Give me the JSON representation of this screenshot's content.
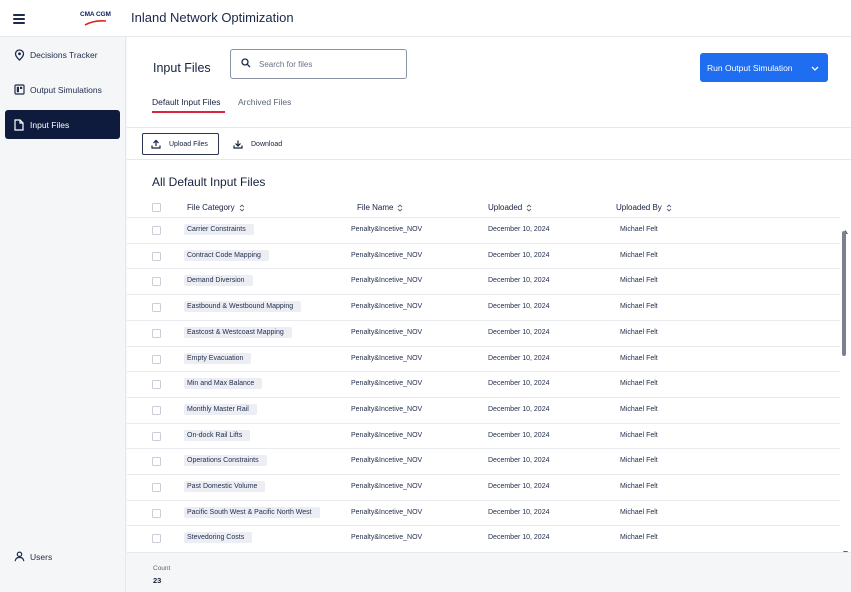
{
  "app": {
    "logo_text": "CMA CGM",
    "title": "Inland Network Optimization"
  },
  "sidebar": {
    "items": [
      {
        "label": "Decisions Tracker",
        "icon": "location-pin-icon"
      },
      {
        "label": "Output Simulations",
        "icon": "dashboard-icon"
      },
      {
        "label": "Input Files",
        "icon": "file-icon",
        "active": true
      }
    ],
    "users_label": "Users"
  },
  "main": {
    "page_title": "Input Files",
    "search_placeholder": "Search for files",
    "run_button_label": "Run Output Simulation",
    "tabs": [
      {
        "label": "Default Input Files",
        "active": true
      },
      {
        "label": "Archived Files",
        "active": false
      }
    ],
    "upload_label": "Upload Files",
    "download_label": "Download",
    "section_title": "All Default Input Files",
    "columns": [
      "File Category",
      "File Name",
      "Uploaded",
      "Uploaded By"
    ],
    "rows": [
      {
        "category": "Carrier Constraints",
        "file": "Penalty&Incetive_NOV",
        "uploaded": "December 10, 2024",
        "by": "Michael Felt"
      },
      {
        "category": "Contract Code Mapping",
        "file": "Penalty&Incetive_NOV",
        "uploaded": "December 10, 2024",
        "by": "Michael Felt"
      },
      {
        "category": "Demand Diversion",
        "file": "Penalty&Incetive_NOV",
        "uploaded": "December 10, 2024",
        "by": "Michael Felt"
      },
      {
        "category": "Eastbound & Westbound Mapping",
        "file": "Penalty&Incetive_NOV",
        "uploaded": "December 10, 2024",
        "by": "Michael Felt"
      },
      {
        "category": "Eastcost & Westcoast Mapping",
        "file": "Penalty&Incetive_NOV",
        "uploaded": "December 10, 2024",
        "by": "Michael Felt"
      },
      {
        "category": "Empty Evacuation",
        "file": "Penalty&Incetive_NOV",
        "uploaded": "December 10, 2024",
        "by": "Michael Felt"
      },
      {
        "category": "Min and Max Balance",
        "file": "Penalty&Incetive_NOV",
        "uploaded": "December 10, 2024",
        "by": "Michael Felt"
      },
      {
        "category": "Monthly Master Rail",
        "file": "Penalty&Incetive_NOV",
        "uploaded": "December 10, 2024",
        "by": "Michael Felt"
      },
      {
        "category": "On-dock Rail Lifts",
        "file": "Penalty&Incetive_NOV",
        "uploaded": "December 10, 2024",
        "by": "Michael Felt"
      },
      {
        "category": "Operations Constraints",
        "file": "Penalty&Incetive_NOV",
        "uploaded": "December 10, 2024",
        "by": "Michael Felt"
      },
      {
        "category": "Past Domestic Volume",
        "file": "Penalty&Incetive_NOV",
        "uploaded": "December 10, 2024",
        "by": "Michael Felt"
      },
      {
        "category": "Pacific South West & Pacific North West",
        "file": "Penalty&Incetive_NOV",
        "uploaded": "December 10, 2024",
        "by": "Michael Felt"
      },
      {
        "category": "Stevedoring Costs",
        "file": "Penalty&Incetive_NOV",
        "uploaded": "December 10, 2024",
        "by": "Michael Felt"
      }
    ],
    "count_label": "Count",
    "count_value": "23"
  },
  "colors": {
    "primary": "#1f6df0",
    "nav_active": "#0e1b3d",
    "tab_accent": "#d7263d",
    "chip_bg": "#eceef4"
  }
}
